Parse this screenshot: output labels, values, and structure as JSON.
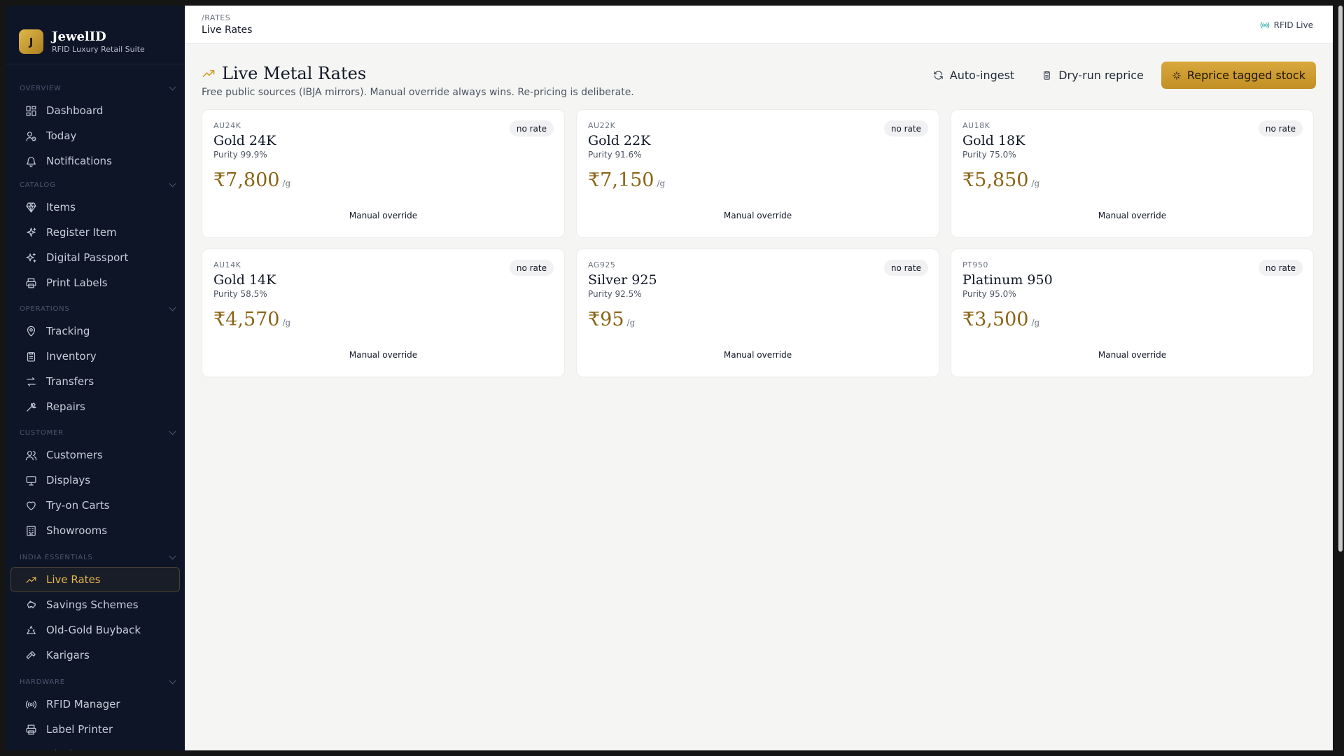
{
  "brand": {
    "initial": "J",
    "name": "JewelID",
    "subtitle": "RFID Luxury Retail Suite"
  },
  "sidebar": {
    "sections": [
      {
        "title": "OVERVIEW",
        "items": [
          {
            "label": "Dashboard",
            "icon": "grid-icon"
          },
          {
            "label": "Today",
            "icon": "user-clock-icon"
          },
          {
            "label": "Notifications",
            "icon": "bell-icon"
          }
        ]
      },
      {
        "title": "CATALOG",
        "items": [
          {
            "label": "Items",
            "icon": "gem-icon"
          },
          {
            "label": "Register Item",
            "icon": "sparkle-icon"
          },
          {
            "label": "Digital Passport",
            "icon": "sparkles-icon"
          },
          {
            "label": "Print Labels",
            "icon": "printer-icon"
          }
        ]
      },
      {
        "title": "OPERATIONS",
        "items": [
          {
            "label": "Tracking",
            "icon": "map-pin-icon"
          },
          {
            "label": "Inventory",
            "icon": "clipboard-icon"
          },
          {
            "label": "Transfers",
            "icon": "arrows-icon"
          },
          {
            "label": "Repairs",
            "icon": "wrench-icon"
          }
        ]
      },
      {
        "title": "CUSTOMER",
        "items": [
          {
            "label": "Customers",
            "icon": "users-icon"
          },
          {
            "label": "Displays",
            "icon": "monitor-icon"
          },
          {
            "label": "Try-on Carts",
            "icon": "heart-icon"
          },
          {
            "label": "Showrooms",
            "icon": "building-icon"
          }
        ]
      },
      {
        "title": "INDIA ESSENTIALS",
        "items": [
          {
            "label": "Live Rates",
            "icon": "trending-up-icon",
            "active": true
          },
          {
            "label": "Savings Schemes",
            "icon": "piggy-bank-icon"
          },
          {
            "label": "Old-Gold Buyback",
            "icon": "recycle-icon"
          },
          {
            "label": "Karigars",
            "icon": "hammer-icon"
          }
        ]
      },
      {
        "title": "HARDWARE",
        "items": [
          {
            "label": "RFID Manager",
            "icon": "radio-icon"
          },
          {
            "label": "Label Printer",
            "icon": "printer-icon"
          },
          {
            "label": "Display Screens",
            "icon": "screen-icon"
          }
        ]
      }
    ]
  },
  "topbar": {
    "breadcrumb": "/RATES",
    "title": "Live Rates",
    "status": "RFID Live"
  },
  "page": {
    "title": "Live Metal Rates",
    "subtitle": "Free public sources (IBJA mirrors). Manual override always wins. Re-pricing is deliberate.",
    "actions": {
      "auto_ingest": "Auto-ingest",
      "dry_run": "Dry-run reprice",
      "reprice": "Reprice tagged stock"
    }
  },
  "rates": [
    {
      "code": "AU24K",
      "name": "Gold 24K",
      "purity": "Purity 99.9%",
      "price": "₹7,800",
      "unit": "/g",
      "badge": "no rate",
      "note": "Manual override"
    },
    {
      "code": "AU22K",
      "name": "Gold 22K",
      "purity": "Purity 91.6%",
      "price": "₹7,150",
      "unit": "/g",
      "badge": "no rate",
      "note": "Manual override"
    },
    {
      "code": "AU18K",
      "name": "Gold 18K",
      "purity": "Purity 75.0%",
      "price": "₹5,850",
      "unit": "/g",
      "badge": "no rate",
      "note": "Manual override"
    },
    {
      "code": "AU14K",
      "name": "Gold 14K",
      "purity": "Purity 58.5%",
      "price": "₹4,570",
      "unit": "/g",
      "badge": "no rate",
      "note": "Manual override"
    },
    {
      "code": "AG925",
      "name": "Silver 925",
      "purity": "Purity 92.5%",
      "price": "₹95",
      "unit": "/g",
      "badge": "no rate",
      "note": "Manual override"
    },
    {
      "code": "PT950",
      "name": "Platinum 950",
      "purity": "Purity 95.0%",
      "price": "₹3,500",
      "unit": "/g",
      "badge": "no rate",
      "note": "Manual override"
    }
  ],
  "colors": {
    "accent": "#d4a032",
    "sidebar_bg": "#0e1526",
    "active_text": "#e5b64a",
    "price": "#8a6416"
  }
}
